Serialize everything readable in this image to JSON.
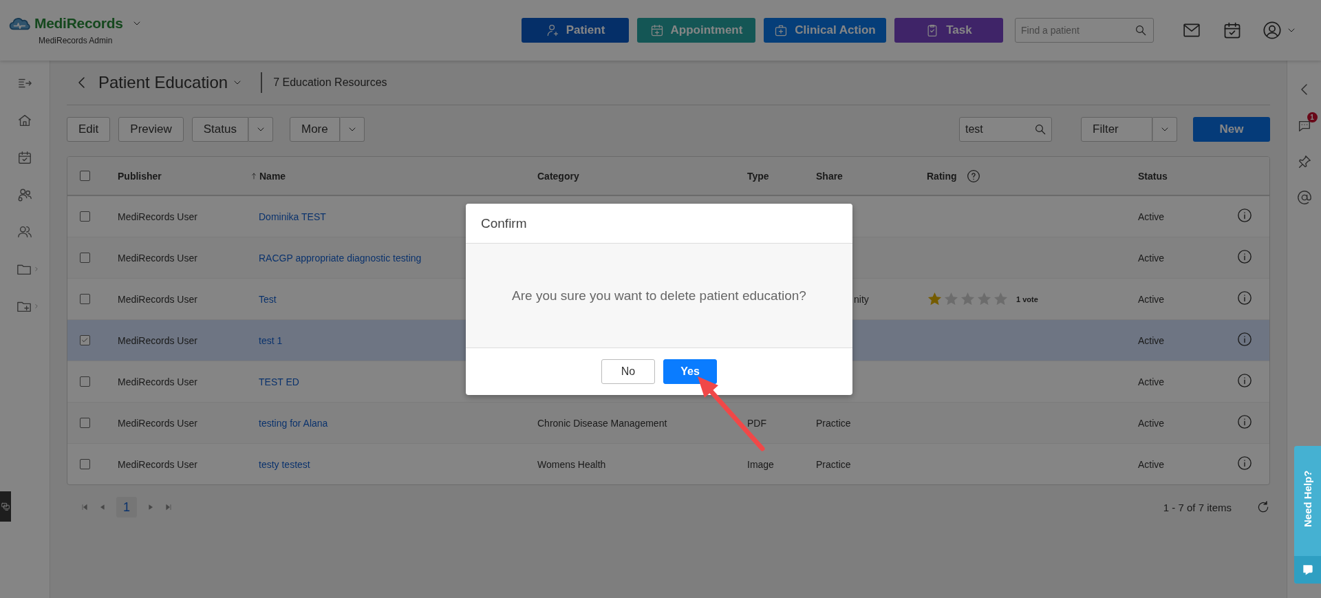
{
  "header": {
    "logo_text": "MediRecords",
    "account": "MediRecords Admin",
    "actions": [
      {
        "label": "Patient",
        "kind": "patient"
      },
      {
        "label": "Appointment",
        "kind": "appointment"
      },
      {
        "label": "Clinical Action",
        "kind": "clinical"
      },
      {
        "label": "Task",
        "kind": "task"
      }
    ],
    "search": {
      "placeholder": "Find a patient"
    }
  },
  "page": {
    "title": "Patient Education",
    "count": "7 Education Resources"
  },
  "toolbar": {
    "buttons": [
      "Edit",
      "Preview"
    ],
    "split_buttons": [
      "Status",
      "More"
    ],
    "search": {
      "value": "test"
    },
    "filter": "Filter",
    "new": "New"
  },
  "table": {
    "header_checkbox": {
      "checked": false
    },
    "columns": [
      {
        "label": "Publisher",
        "sorted": false,
        "help": false
      },
      {
        "label": "Name",
        "sorted": true,
        "help": false
      },
      {
        "label": "Category",
        "sorted": false,
        "help": false
      },
      {
        "label": "Type",
        "sorted": false,
        "help": false
      },
      {
        "label": "Share",
        "sorted": false,
        "help": false
      },
      {
        "label": "Rating",
        "sorted": false,
        "help": true
      },
      {
        "label": "Status",
        "sorted": false,
        "help": false
      }
    ],
    "rows": [
      {
        "checked": false,
        "selected": false,
        "publisher": "MediRecords User",
        "name": "Dominika TEST",
        "status": "Active"
      },
      {
        "checked": false,
        "selected": false,
        "publisher": "MediRecords User",
        "name": "RACGP appropriate diagnostic testing",
        "status": "Active"
      },
      {
        "checked": false,
        "selected": false,
        "publisher": "MediRecords User",
        "name": "Test",
        "share": "nity",
        "share_clipped": true,
        "rating": {
          "stars": 1,
          "votes": "1 vote"
        },
        "status": "Active"
      },
      {
        "checked": true,
        "selected": true,
        "publisher": "MediRecords User",
        "name": "test 1",
        "status": "Active"
      },
      {
        "checked": false,
        "selected": false,
        "publisher": "MediRecords User",
        "name": "TEST ED",
        "status": "Active"
      },
      {
        "checked": false,
        "selected": false,
        "publisher": "MediRecords User",
        "name": "testing for Alana",
        "category": "Chronic Disease Management",
        "type": "PDF",
        "share": "Practice",
        "share_clipped": false,
        "status": "Active"
      },
      {
        "checked": false,
        "selected": false,
        "publisher": "MediRecords User",
        "name": "testy testest",
        "category": "Womens Health",
        "type": "Image",
        "share": "Practice",
        "share_clipped": false,
        "status": "Active"
      }
    ]
  },
  "pager": {
    "pages": [
      {
        "label": "1",
        "selected": true
      }
    ],
    "summary": "1 - 7 of 7 items"
  },
  "rail": {
    "badge": "1"
  },
  "dialog": {
    "title": "Confirm",
    "message": "Are you sure you want to delete patient education?",
    "buttons": [
      {
        "label": "No",
        "kind": "secondary"
      },
      {
        "label": "Yes",
        "kind": "primary"
      }
    ]
  },
  "help_tab": "Need Help?"
}
